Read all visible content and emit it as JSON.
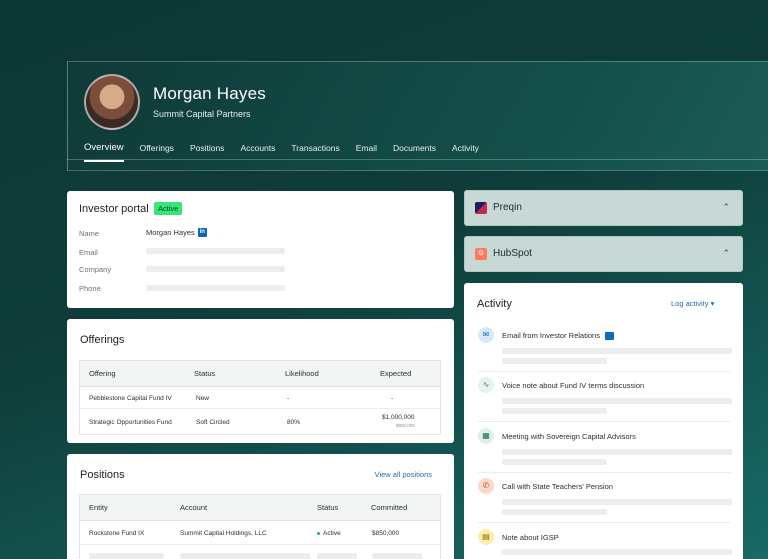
{
  "profile": {
    "name": "Morgan Hayes",
    "company": "Summit Capital Partners"
  },
  "tabs": [
    "Overview",
    "Offerings",
    "Positions",
    "Accounts",
    "Transactions",
    "Email",
    "Documents",
    "Activity"
  ],
  "portal": {
    "title": "Investor portal",
    "badge": "Active",
    "fields": {
      "name_label": "Name",
      "name_value": "Morgan Hayes",
      "email_label": "Email",
      "company_label": "Company",
      "phone_label": "Phone"
    }
  },
  "offerings": {
    "title": "Offerings",
    "columns": [
      "Offering",
      "Status",
      "Likelihood",
      "Expected"
    ],
    "rows": [
      {
        "offering": "Pebblestone Capital Fund IV",
        "status": "New",
        "likelihood": "-",
        "expected": "-",
        "expected_sub": ""
      },
      {
        "offering": "Strategic Opportunities Fund",
        "status": "Soft Circled",
        "likelihood": "80%",
        "expected": "$1,000,000",
        "expected_sub": "$800,000"
      }
    ]
  },
  "positions": {
    "title": "Positions",
    "view_all": "View all positions",
    "columns": [
      "Entity",
      "Account",
      "Status",
      "Committed"
    ],
    "rows": [
      {
        "entity": "Rockstone Fund IX",
        "account": "Summit Capital Holdings, LLC",
        "status": "Active",
        "committed": "$850,000"
      }
    ]
  },
  "panels": {
    "preqin": "Preqin",
    "hubspot": "HubSpot"
  },
  "activity": {
    "title": "Activity",
    "log_label": "Log activity",
    "items": [
      {
        "text": "Email from Investor Relations",
        "icon": "mail-icon"
      },
      {
        "text": "Voice note about Fund IV terms discussion",
        "icon": "waveform-icon"
      },
      {
        "text": "Meeting with Sovereign Capital Advisors",
        "icon": "calendar-icon"
      },
      {
        "text": "Call with State Teachers' Pension",
        "icon": "phone-icon"
      },
      {
        "text": "Note about IGSP",
        "icon": "note-icon"
      }
    ]
  },
  "colors": {
    "accent": "#1f6fb0",
    "active_badge": "#37e57b",
    "background": "#0f3d3a"
  }
}
